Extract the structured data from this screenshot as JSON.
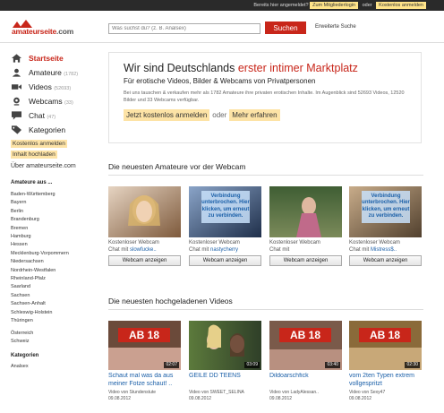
{
  "topbar": {
    "question": "Bereits hier angemeldet?",
    "login": "Zum Mitgliederlogin",
    "or": "oder",
    "register": "Kostenlos anmelden"
  },
  "header": {
    "logo_main": "amateurseite",
    "logo_tld": ".com",
    "search_placeholder": "Was suchst du? (z. B. Analsex)",
    "search_button": "Suchen",
    "advanced_search": "Erweiterte Suche"
  },
  "sidebar": {
    "nav": [
      {
        "label": "Startseite",
        "count": "",
        "icon": "home-icon"
      },
      {
        "label": "Amateure",
        "count": "(1782)",
        "icon": "user-icon"
      },
      {
        "label": "Videos",
        "count": "(52693)",
        "icon": "video-camera-icon"
      },
      {
        "label": "Webcams",
        "count": "(33)",
        "icon": "webcam-icon"
      },
      {
        "label": "Chat",
        "count": "(47)",
        "icon": "chat-icon"
      },
      {
        "label": "Kategorien",
        "count": "",
        "icon": "tag-icon"
      }
    ],
    "register_link": "Kostenlos anmelden",
    "upload_link": "Inhalt hochladen",
    "about_link": "Über amateurseite.com",
    "regions_title": "Amateure aus ...",
    "regions": [
      "Baden-Württemberg",
      "Bayern",
      "Berlin",
      "Brandenburg",
      "Bremen",
      "Hamburg",
      "Hessen",
      "Mecklenburg-Vorpommern",
      "Niedersachsen",
      "Nordrhein-Westfalen",
      "Rheinland-Pfalz",
      "Saarland",
      "Sachsen",
      "Sachsen-Anhalt",
      "Schleswig-Holstein",
      "Thüringen"
    ],
    "countries": [
      "Österreich",
      "Schweiz"
    ],
    "categories_title": "Kategorien",
    "categories_first": "Analsex"
  },
  "promo": {
    "title_prefix": "Wir sind Deutschlands",
    "title_highlight": "erster intimer Marktplatz",
    "subtitle": "Für erotische Videos, Bilder & Webcams von Privatpersonen",
    "text": "Bei uns tauschen & verkaufen mehr als 1782 Amateure ihre privaten erotischen Inhalte. Im Augenblick sind 52693 Videos, 12520 Bilder und 33 Webcams verfügbar.",
    "cta_register": "Jetzt kostenlos anmelden",
    "cta_or": "oder",
    "cta_more": "Mehr erfahren"
  },
  "webcams": {
    "section_title": "Die neuesten Amateure vor der Webcam",
    "label": "Kostenloser Webcam",
    "chat_with": "Chat mit",
    "overlay_text": "Verbindung unterbrochen. Hier klicken, um erneut zu verbinden.",
    "button": "Webcam anzeigen",
    "items": [
      {
        "name": "slowfucke..",
        "overlay": false,
        "colors": [
          "#d9c4b2",
          "#7e5a3c"
        ]
      },
      {
        "name": "nastycherry",
        "overlay": true,
        "colors": [
          "#6d8cb4",
          "#1f2f4a"
        ]
      },
      {
        "name": "",
        "overlay": false,
        "colors": [
          "#4a6a3c",
          "#c06a8a"
        ]
      },
      {
        "name": "Mistress$..",
        "overlay": true,
        "colors": [
          "#b89a78",
          "#51402e"
        ]
      }
    ]
  },
  "videos": {
    "section_title": "Die neuesten hochgeladenen Videos",
    "badge": "AB 18",
    "by": "Video von",
    "items": [
      {
        "title": "Schaut mal was da aus meiner Fotze schaut! ..",
        "author": "Stundenstute",
        "date": "09.08.2012",
        "duration": "02:07",
        "badge": true
      },
      {
        "title": "GEILE DD TEENS",
        "author": "SWEET_SELINA",
        "date": "09.08.2012",
        "duration": "03:09",
        "badge": false
      },
      {
        "title": "Dildoarschfick",
        "author": "LadyAlessan..",
        "date": "09.08.2012",
        "duration": "03:40",
        "badge": true
      },
      {
        "title": "vom 2ten Typen extrem vollgespritzt",
        "author": "Sexy47",
        "date": "09.08.2012",
        "duration": "02:30",
        "badge": true
      }
    ]
  },
  "colors": {
    "brand_red": "#c8261a",
    "highlight": "#fde3a6",
    "link_blue": "#1a5fa8"
  }
}
